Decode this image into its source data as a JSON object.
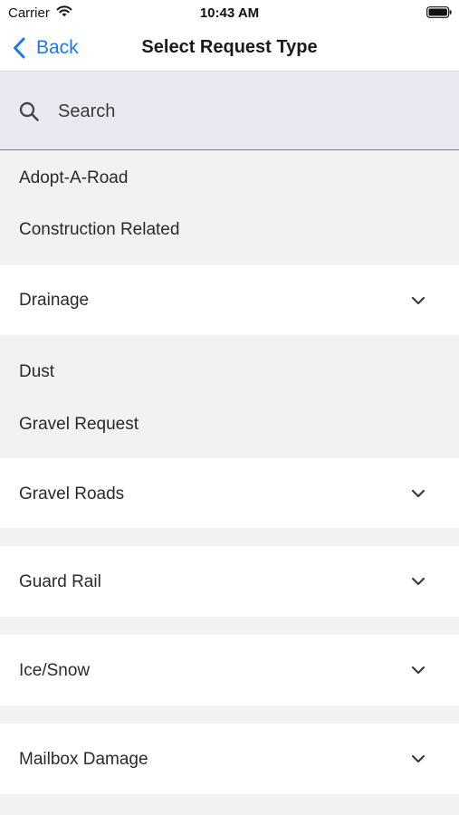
{
  "status_bar": {
    "carrier": "Carrier",
    "time": "10:43 AM",
    "wifi_icon": "wifi-icon",
    "battery_icon": "battery-icon"
  },
  "nav": {
    "back_label": "Back",
    "title": "Select Request Type",
    "accent_color": "#1a7ae8"
  },
  "search": {
    "placeholder": "Search",
    "value": "",
    "icon": "search-icon"
  },
  "items": [
    {
      "label": "Adopt-A-Road",
      "expandable": false
    },
    {
      "label": "Construction Related",
      "expandable": false
    },
    {
      "label": "Drainage",
      "expandable": true
    },
    {
      "label": "Dust",
      "expandable": false
    },
    {
      "label": "Gravel Request",
      "expandable": false
    },
    {
      "label": "Gravel Roads",
      "expandable": true
    },
    {
      "label": "Guard Rail",
      "expandable": true
    },
    {
      "label": "Ice/Snow",
      "expandable": true
    },
    {
      "label": "Mailbox Damage",
      "expandable": true
    }
  ]
}
